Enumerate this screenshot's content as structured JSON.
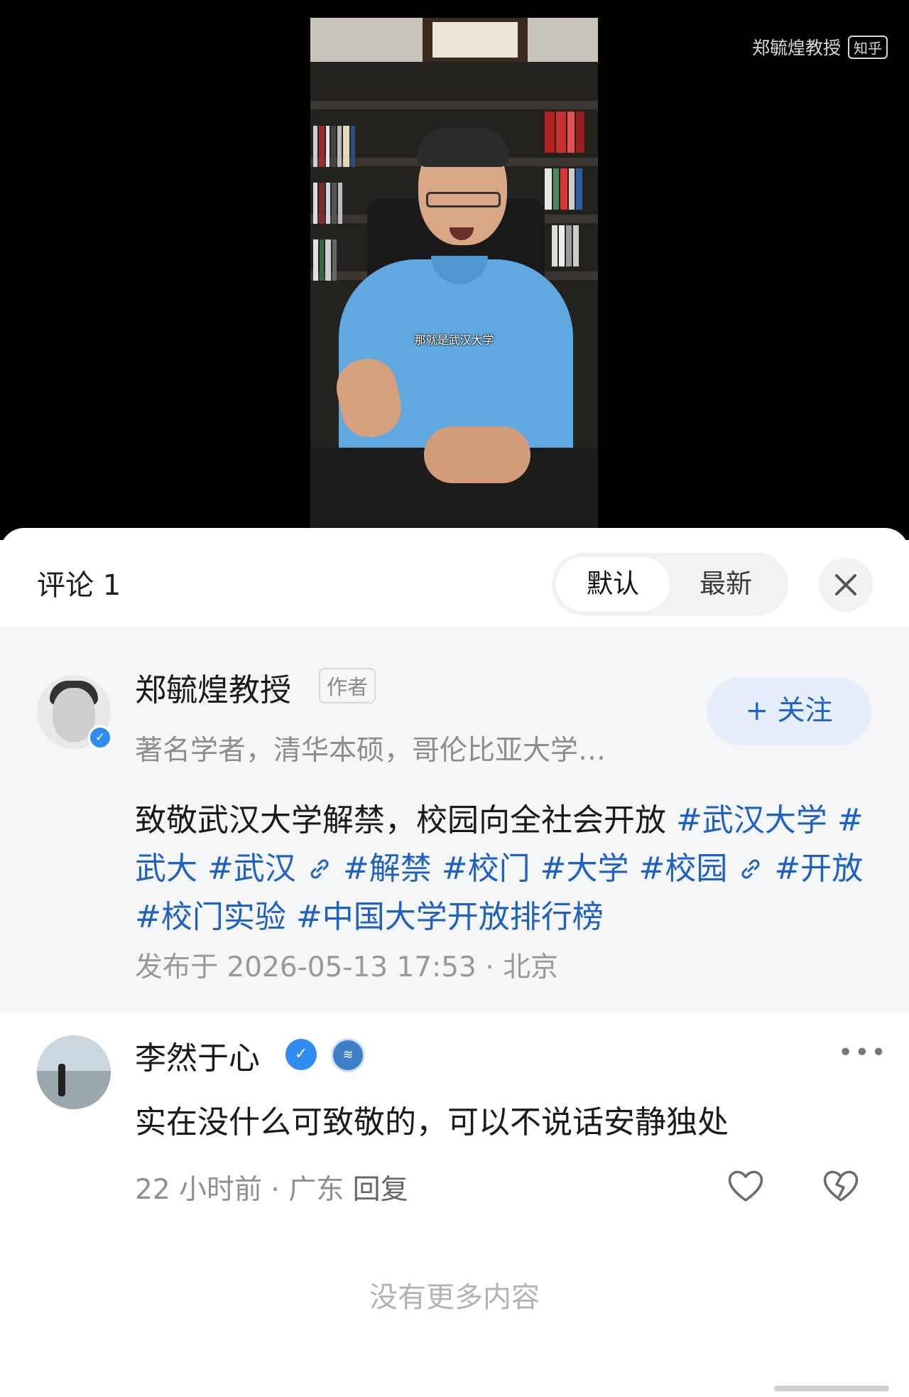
{
  "video": {
    "subtitle": "那就是武汉大学",
    "watermark_name": "郑毓煌教授",
    "watermark_brand": "知乎"
  },
  "comments_header": {
    "title": "评论 1",
    "sort_options": [
      "默认",
      "最新"
    ],
    "selected_sort": "默认",
    "close_icon": "close-icon"
  },
  "post": {
    "author_name": "郑毓煌教授",
    "author_tag": "作者",
    "author_bio": "著名学者，清华本硕，哥伦比亚大学…",
    "follow_label": "+ 关注",
    "text_plain": "致敬武汉大学解禁，校园向全社会开放",
    "hashtags": [
      "#武汉大学",
      "#武大",
      "#武汉",
      "#解禁",
      "#校门",
      "#大学",
      "#校园",
      "#开放",
      "#校门实验",
      "#中国大学开放排行榜"
    ],
    "text_line1": "致敬武汉大学解禁，校园向全社会开放",
    "hashtag_wrap_a": "#武汉大",
    "hashtag_wrap_b": "学",
    "meta": "发布于 2026-05-13 17:53 · 北京"
  },
  "comment": {
    "user_name": "李然于心",
    "level_icon": "level-badge-icon",
    "text": "实在没什么可致敬的，可以不说话安静独处",
    "meta": "22 小时前 · 广东",
    "reply_label": "回复",
    "more_icon": "more-icon"
  },
  "footer": {
    "end_text": "没有更多内容"
  },
  "colors": {
    "hashtag": "#1e61c3",
    "verified": "#2f8cf0",
    "follow_bg": "#e6eefb"
  }
}
